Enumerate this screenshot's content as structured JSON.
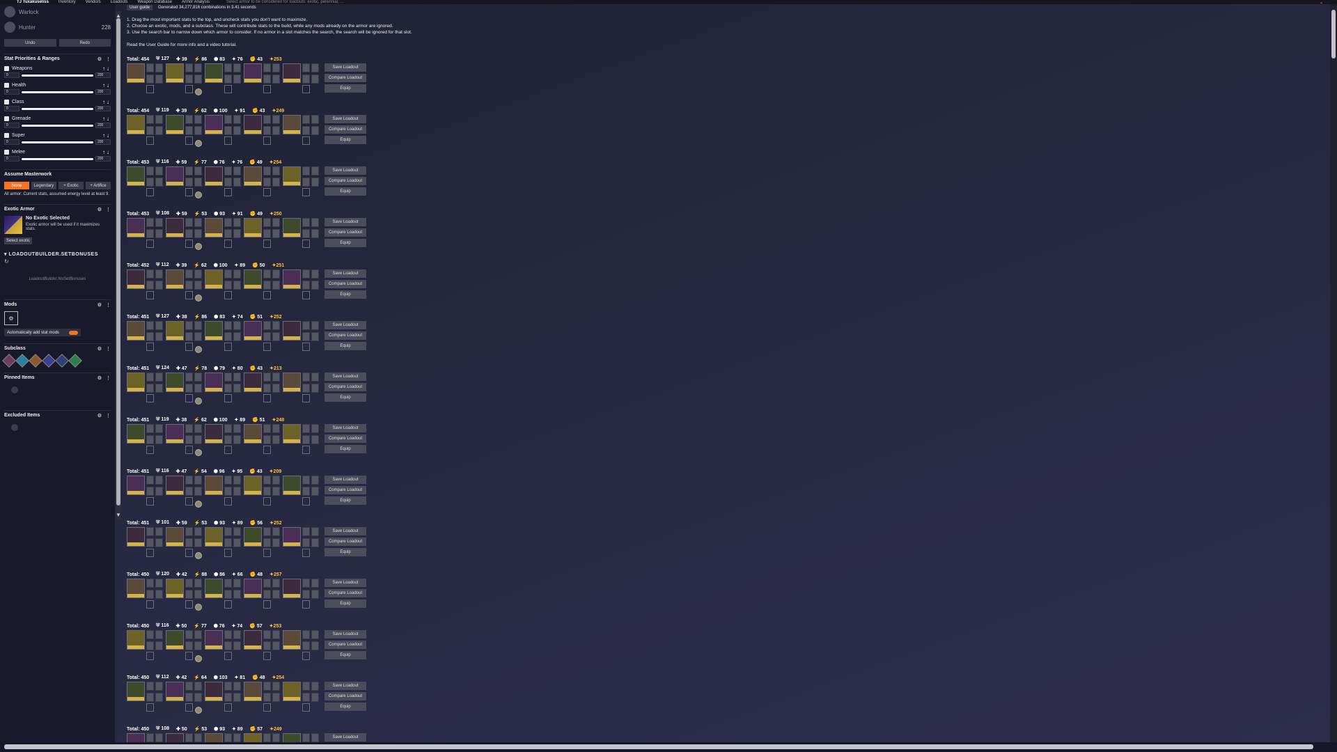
{
  "topbar": {
    "brand": "TJ Tuxakuseliss",
    "nav": [
      "Inventory",
      "Vendors",
      "Loadouts",
      "Weapon Database",
      "Armor Analysis"
    ],
    "search_placeholder": "Select armor to be considered for loadouts: exotic, perennial, …"
  },
  "characters": [
    {
      "name": "Warlock",
      "sub": "Combatant",
      "power": ""
    },
    {
      "name": "Hunter",
      "sub": "Star Eater",
      "power": "228"
    }
  ],
  "undo": {
    "undo": "Undo",
    "redo": "Redo"
  },
  "stat_section": {
    "title": "Stat Priorities & Ranges",
    "stats": [
      {
        "name": "Weapons",
        "min": "0",
        "max": "200"
      },
      {
        "name": "Health",
        "min": "0",
        "max": "200"
      },
      {
        "name": "Class",
        "min": "0",
        "max": "200"
      },
      {
        "name": "Grenade",
        "min": "0",
        "max": "200"
      },
      {
        "name": "Super",
        "min": "0",
        "max": "200"
      },
      {
        "name": "Melee",
        "min": "0",
        "max": "200"
      }
    ]
  },
  "masterwork": {
    "title": "Assume Masterwork",
    "options": [
      "None",
      "Legendary",
      "+ Exotic",
      "+ Artifice"
    ],
    "active": "None",
    "note": "All armor: Current stats, assumed energy level at least 9."
  },
  "exotic": {
    "title": "Exotic Armor",
    "name": "No Exotic Selected",
    "desc": "Exotic armor will be used if it maximizes stats.",
    "button": "Select exotic"
  },
  "setbonus": {
    "title": "LOADOUTBUILDER.SETBONUSES",
    "empty": "LoadoutBuilder.NoSetBonuses"
  },
  "mods": {
    "title": "Mods",
    "auto_label": "Automatically add stat mods"
  },
  "subclass": {
    "title": "Subclass"
  },
  "pinned": {
    "title": "Pinned Items"
  },
  "excluded": {
    "title": "Excluded Items"
  },
  "header": {
    "guide": "User guide",
    "generated": "Generated 34,277,816 combinations in 3.41 seconds"
  },
  "instructions": [
    "1. Drag the most important stats to the top, and uncheck stats you don't want to maximize.",
    "2. Choose an exotic, mods, and a subclass. These will contribute stats to the build, while any mods already on the armor are ignored.",
    "3. Use the search bar to narrow down which armor to consider. If no armor in a slot matches the search, the search will be ignored for that slot.",
    "Read the User Guide for more info and a video tutorial."
  ],
  "actions": {
    "save": "Save Loadout",
    "compare": "Compare Loadout",
    "equip": "Equip"
  },
  "results": [
    {
      "total": "Total: 454",
      "stats": [
        "127",
        "39",
        "86",
        "83",
        "76",
        "43"
      ],
      "power": "253"
    },
    {
      "total": "Total: 454",
      "stats": [
        "119",
        "39",
        "62",
        "100",
        "91",
        "43"
      ],
      "power": "249"
    },
    {
      "total": "Total: 453",
      "stats": [
        "116",
        "59",
        "77",
        "76",
        "76",
        "49"
      ],
      "power": "254"
    },
    {
      "total": "Total: 453",
      "stats": [
        "108",
        "59",
        "53",
        "93",
        "91",
        "49"
      ],
      "power": "250"
    },
    {
      "total": "Total: 452",
      "stats": [
        "112",
        "39",
        "62",
        "100",
        "89",
        "50"
      ],
      "power": "251"
    },
    {
      "total": "Total: 451",
      "stats": [
        "127",
        "38",
        "86",
        "83",
        "74",
        "51"
      ],
      "power": "252"
    },
    {
      "total": "Total: 451",
      "stats": [
        "124",
        "47",
        "78",
        "79",
        "80",
        "43"
      ],
      "power": "213"
    },
    {
      "total": "Total: 451",
      "stats": [
        "119",
        "38",
        "62",
        "100",
        "89",
        "51"
      ],
      "power": "248"
    },
    {
      "total": "Total: 451",
      "stats": [
        "116",
        "47",
        "54",
        "96",
        "95",
        "43"
      ],
      "power": "209"
    },
    {
      "total": "Total: 451",
      "stats": [
        "101",
        "59",
        "53",
        "93",
        "89",
        "56"
      ],
      "power": "252"
    },
    {
      "total": "Total: 450",
      "stats": [
        "120",
        "42",
        "88",
        "86",
        "66",
        "48"
      ],
      "power": "257"
    },
    {
      "total": "Total: 450",
      "stats": [
        "116",
        "50",
        "77",
        "76",
        "74",
        "57"
      ],
      "power": "253"
    },
    {
      "total": "Total: 450",
      "stats": [
        "112",
        "42",
        "64",
        "103",
        "81",
        "48"
      ],
      "power": "254"
    },
    {
      "total": "Total: 450",
      "stats": [
        "108",
        "50",
        "53",
        "93",
        "89",
        "57"
      ],
      "power": "249"
    }
  ],
  "colors": {
    "accent": "#f37423",
    "power": "#f6c544",
    "sidebar": "#18192a"
  }
}
